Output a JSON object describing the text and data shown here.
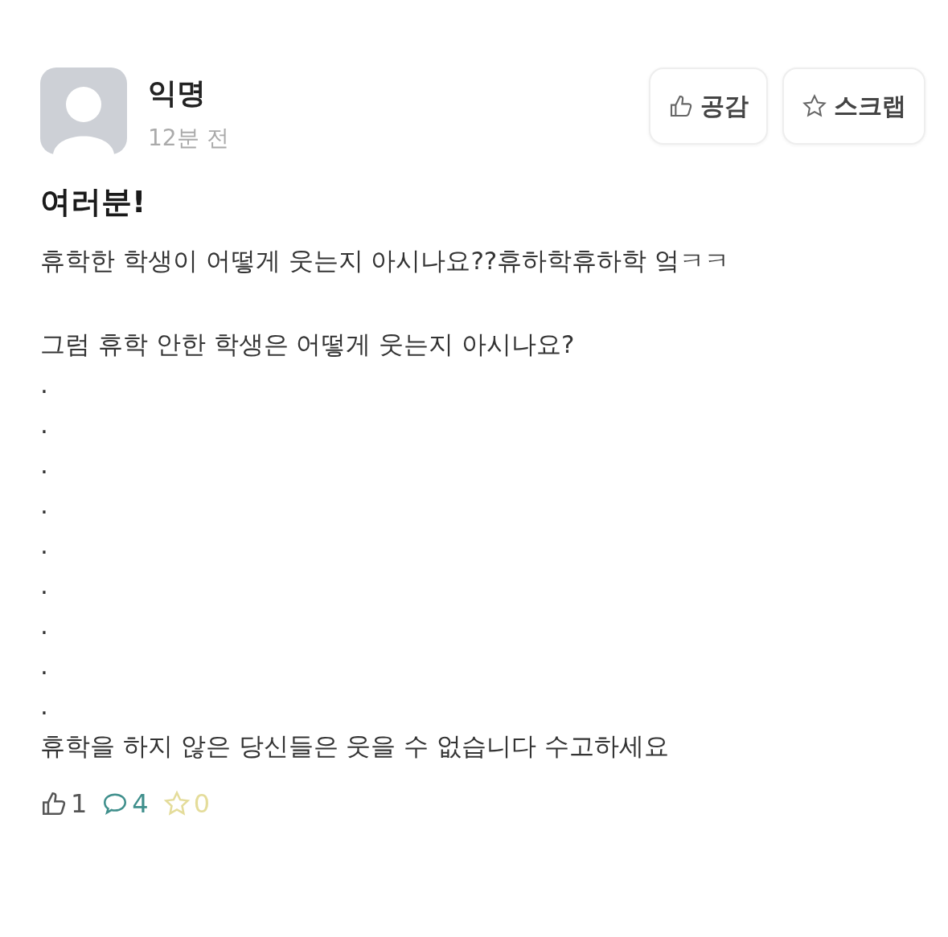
{
  "author": {
    "name": "익명",
    "time": "12분 전"
  },
  "actions": [
    {
      "kind": "like",
      "label": "공감"
    },
    {
      "kind": "scrap",
      "label": "스크랩"
    }
  ],
  "title": "여러분!",
  "paragraphs": [
    {
      "kind": "text",
      "text": "휴학한 학생이 어떻게 웃는지 아시나요??휴하학휴하학 엌ㅋㅋ"
    },
    {
      "kind": "text",
      "text": "그럼 휴학 안한 학생은 어떻게 웃는지 아시나요?"
    },
    {
      "kind": "dot",
      "text": "."
    },
    {
      "kind": "dot",
      "text": "."
    },
    {
      "kind": "dot",
      "text": "."
    },
    {
      "kind": "dot",
      "text": "."
    },
    {
      "kind": "dot",
      "text": "."
    },
    {
      "kind": "dot",
      "text": "."
    },
    {
      "kind": "dot",
      "text": "."
    },
    {
      "kind": "dot",
      "text": "."
    },
    {
      "kind": "dot",
      "text": "."
    },
    {
      "kind": "last",
      "text": "휴학을 하지 않은 당신들은 웃을 수 없습니다 수고하세요"
    }
  ],
  "stats": [
    {
      "kind": "like",
      "count": "1",
      "color": "#555555"
    },
    {
      "kind": "comment",
      "count": "4",
      "color": "#3f8f8c"
    },
    {
      "kind": "scrap",
      "count": "0",
      "color": "#e4dc9a"
    }
  ]
}
